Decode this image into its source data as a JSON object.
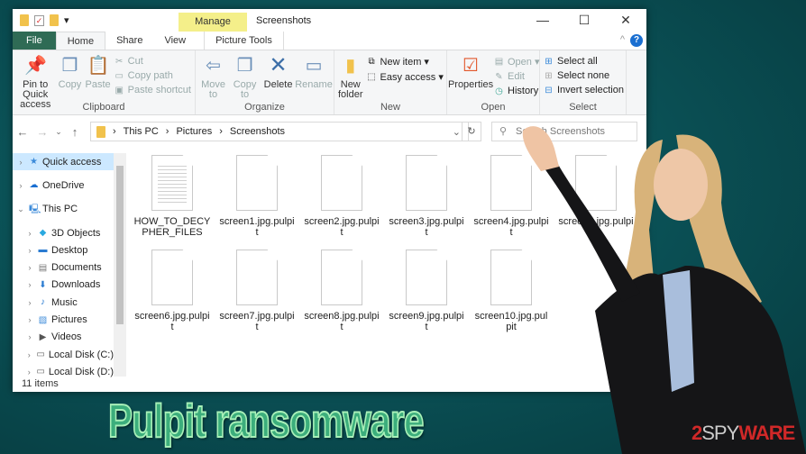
{
  "window": {
    "title": "Screenshots",
    "context_tab": "Manage",
    "context_group": "Picture Tools"
  },
  "tabs": [
    "File",
    "Home",
    "Share",
    "View",
    "Picture Tools"
  ],
  "ribbon": {
    "clipboard": {
      "label": "Clipboard",
      "pin": "Pin to Quick access",
      "copy": "Copy",
      "paste": "Paste",
      "cut": "Cut",
      "copy_path": "Copy path",
      "paste_shortcut": "Paste shortcut"
    },
    "organize": {
      "label": "Organize",
      "move_to": "Move to",
      "copy_to": "Copy to",
      "delete": "Delete",
      "rename": "Rename"
    },
    "new": {
      "label": "New",
      "new_folder": "New folder",
      "new_item": "New item ▾",
      "easy_access": "Easy access ▾"
    },
    "open": {
      "label": "Open",
      "properties": "Properties",
      "open": "Open ▾",
      "edit": "Edit",
      "history": "History"
    },
    "select": {
      "label": "Select",
      "all": "Select all",
      "none": "Select none",
      "invert": "Invert selection"
    }
  },
  "address": {
    "crumbs": [
      "This PC",
      "Pictures",
      "Screenshots"
    ],
    "search_placeholder": "Search Screenshots"
  },
  "nav": [
    {
      "label": "Quick access",
      "icon": "star-icon",
      "selected": true
    },
    {
      "label": "OneDrive",
      "icon": "cloud-icon"
    },
    {
      "label": "This PC",
      "icon": "computer-icon",
      "expanded": true
    },
    {
      "label": "3D Objects",
      "icon": "cube-icon"
    },
    {
      "label": "Desktop",
      "icon": "desktop-icon"
    },
    {
      "label": "Documents",
      "icon": "document-icon"
    },
    {
      "label": "Downloads",
      "icon": "download-icon"
    },
    {
      "label": "Music",
      "icon": "music-icon"
    },
    {
      "label": "Pictures",
      "icon": "picture-icon"
    },
    {
      "label": "Videos",
      "icon": "video-icon"
    },
    {
      "label": "Local Disk (C:)",
      "icon": "disk-icon"
    },
    {
      "label": "Local Disk (D:)",
      "icon": "disk-icon"
    }
  ],
  "files": [
    "HOW_TO_DECYPHER_FILES",
    "screen1.jpg.pulpit",
    "screen2.jpg.pulpit",
    "screen3.jpg.pulpit",
    "screen4.jpg.pulpit",
    "screen5.jpg.pulpit",
    "screen6.jpg.pulpit",
    "screen7.jpg.pulpit",
    "screen8.jpg.pulpit",
    "screen9.jpg.pulpit",
    "screen10.jpg.pulpit"
  ],
  "status": "11 items",
  "headline": "Pulpit ransomware",
  "logo": "2SPYWARE"
}
